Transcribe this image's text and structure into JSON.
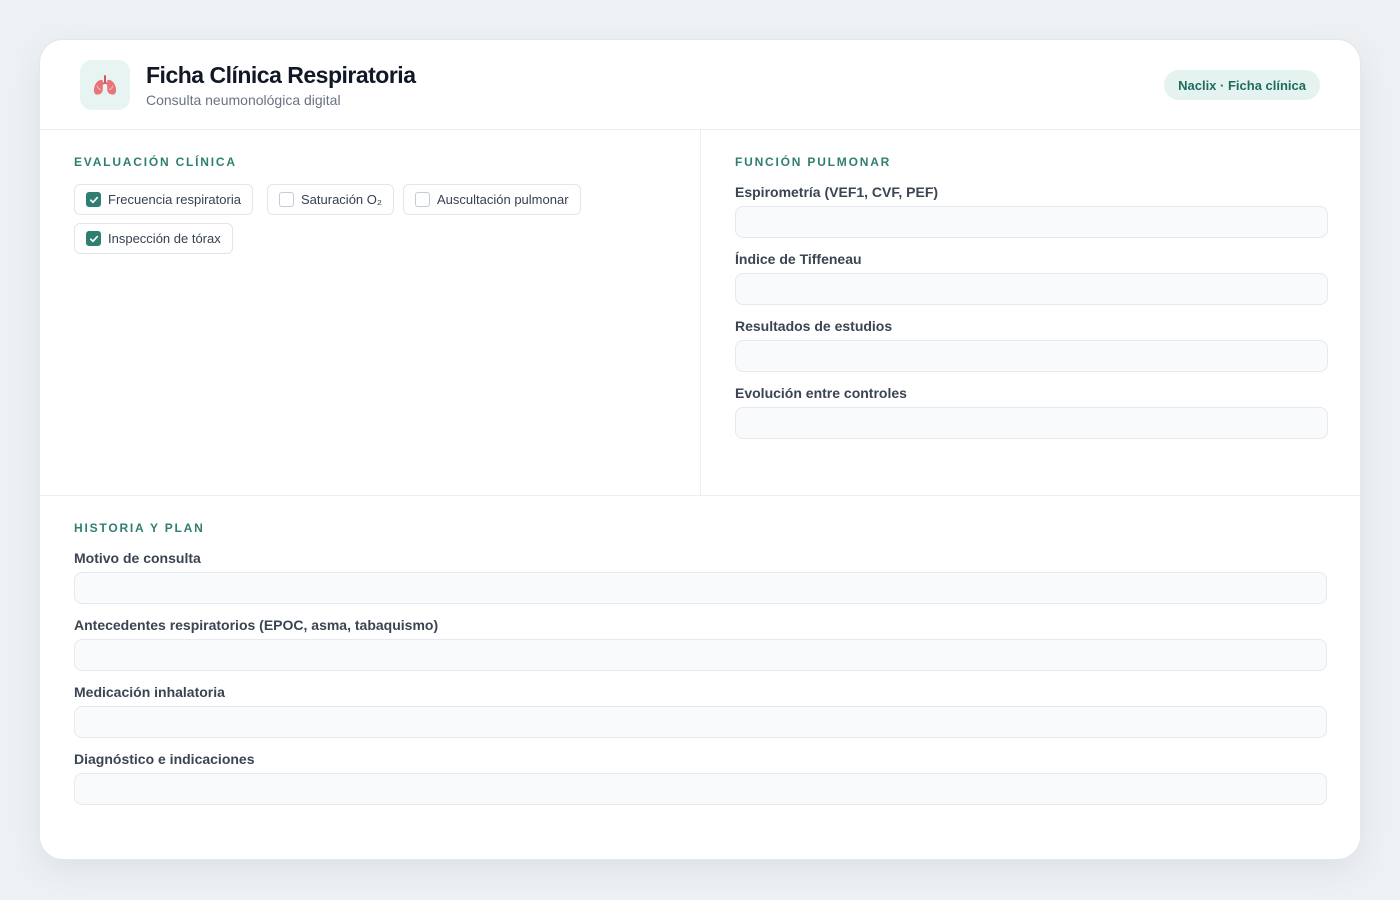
{
  "header": {
    "title": "Ficha Clínica Respiratoria",
    "subtitle": "Consulta neumonológica digital",
    "badge": "Naclix · Ficha clínica",
    "logo_icon": "lungs-icon"
  },
  "evaluacion": {
    "title": "Evaluación clínica",
    "checks": [
      {
        "label": "Frecuencia respiratoria",
        "checked": true
      },
      {
        "label": "Saturación O₂",
        "checked": false
      },
      {
        "label": "Auscultación pulmonar",
        "checked": false
      },
      {
        "label": "Inspección de tórax",
        "checked": true
      }
    ]
  },
  "funcion": {
    "title": "Función pulmonar",
    "fields": [
      {
        "label": "Espirometría (VEF1, CVF, PEF)",
        "value": ""
      },
      {
        "label": "Índice de Tiffeneau",
        "value": ""
      },
      {
        "label": "Resultados de estudios",
        "value": ""
      },
      {
        "label": "Evolución entre controles",
        "value": ""
      }
    ]
  },
  "historia": {
    "title": "Historia y plan",
    "fields": [
      {
        "label": "Motivo de consulta",
        "value": ""
      },
      {
        "label": "Antecedentes respiratorios (EPOC, asma, tabaquismo)",
        "value": ""
      },
      {
        "label": "Medicación inhalatoria",
        "value": ""
      },
      {
        "label": "Diagnóstico e indicaciones",
        "value": ""
      }
    ]
  },
  "colors": {
    "accent": "#2f7f70",
    "badge_bg": "#e4f3ef",
    "lungs": "#e8737a"
  }
}
